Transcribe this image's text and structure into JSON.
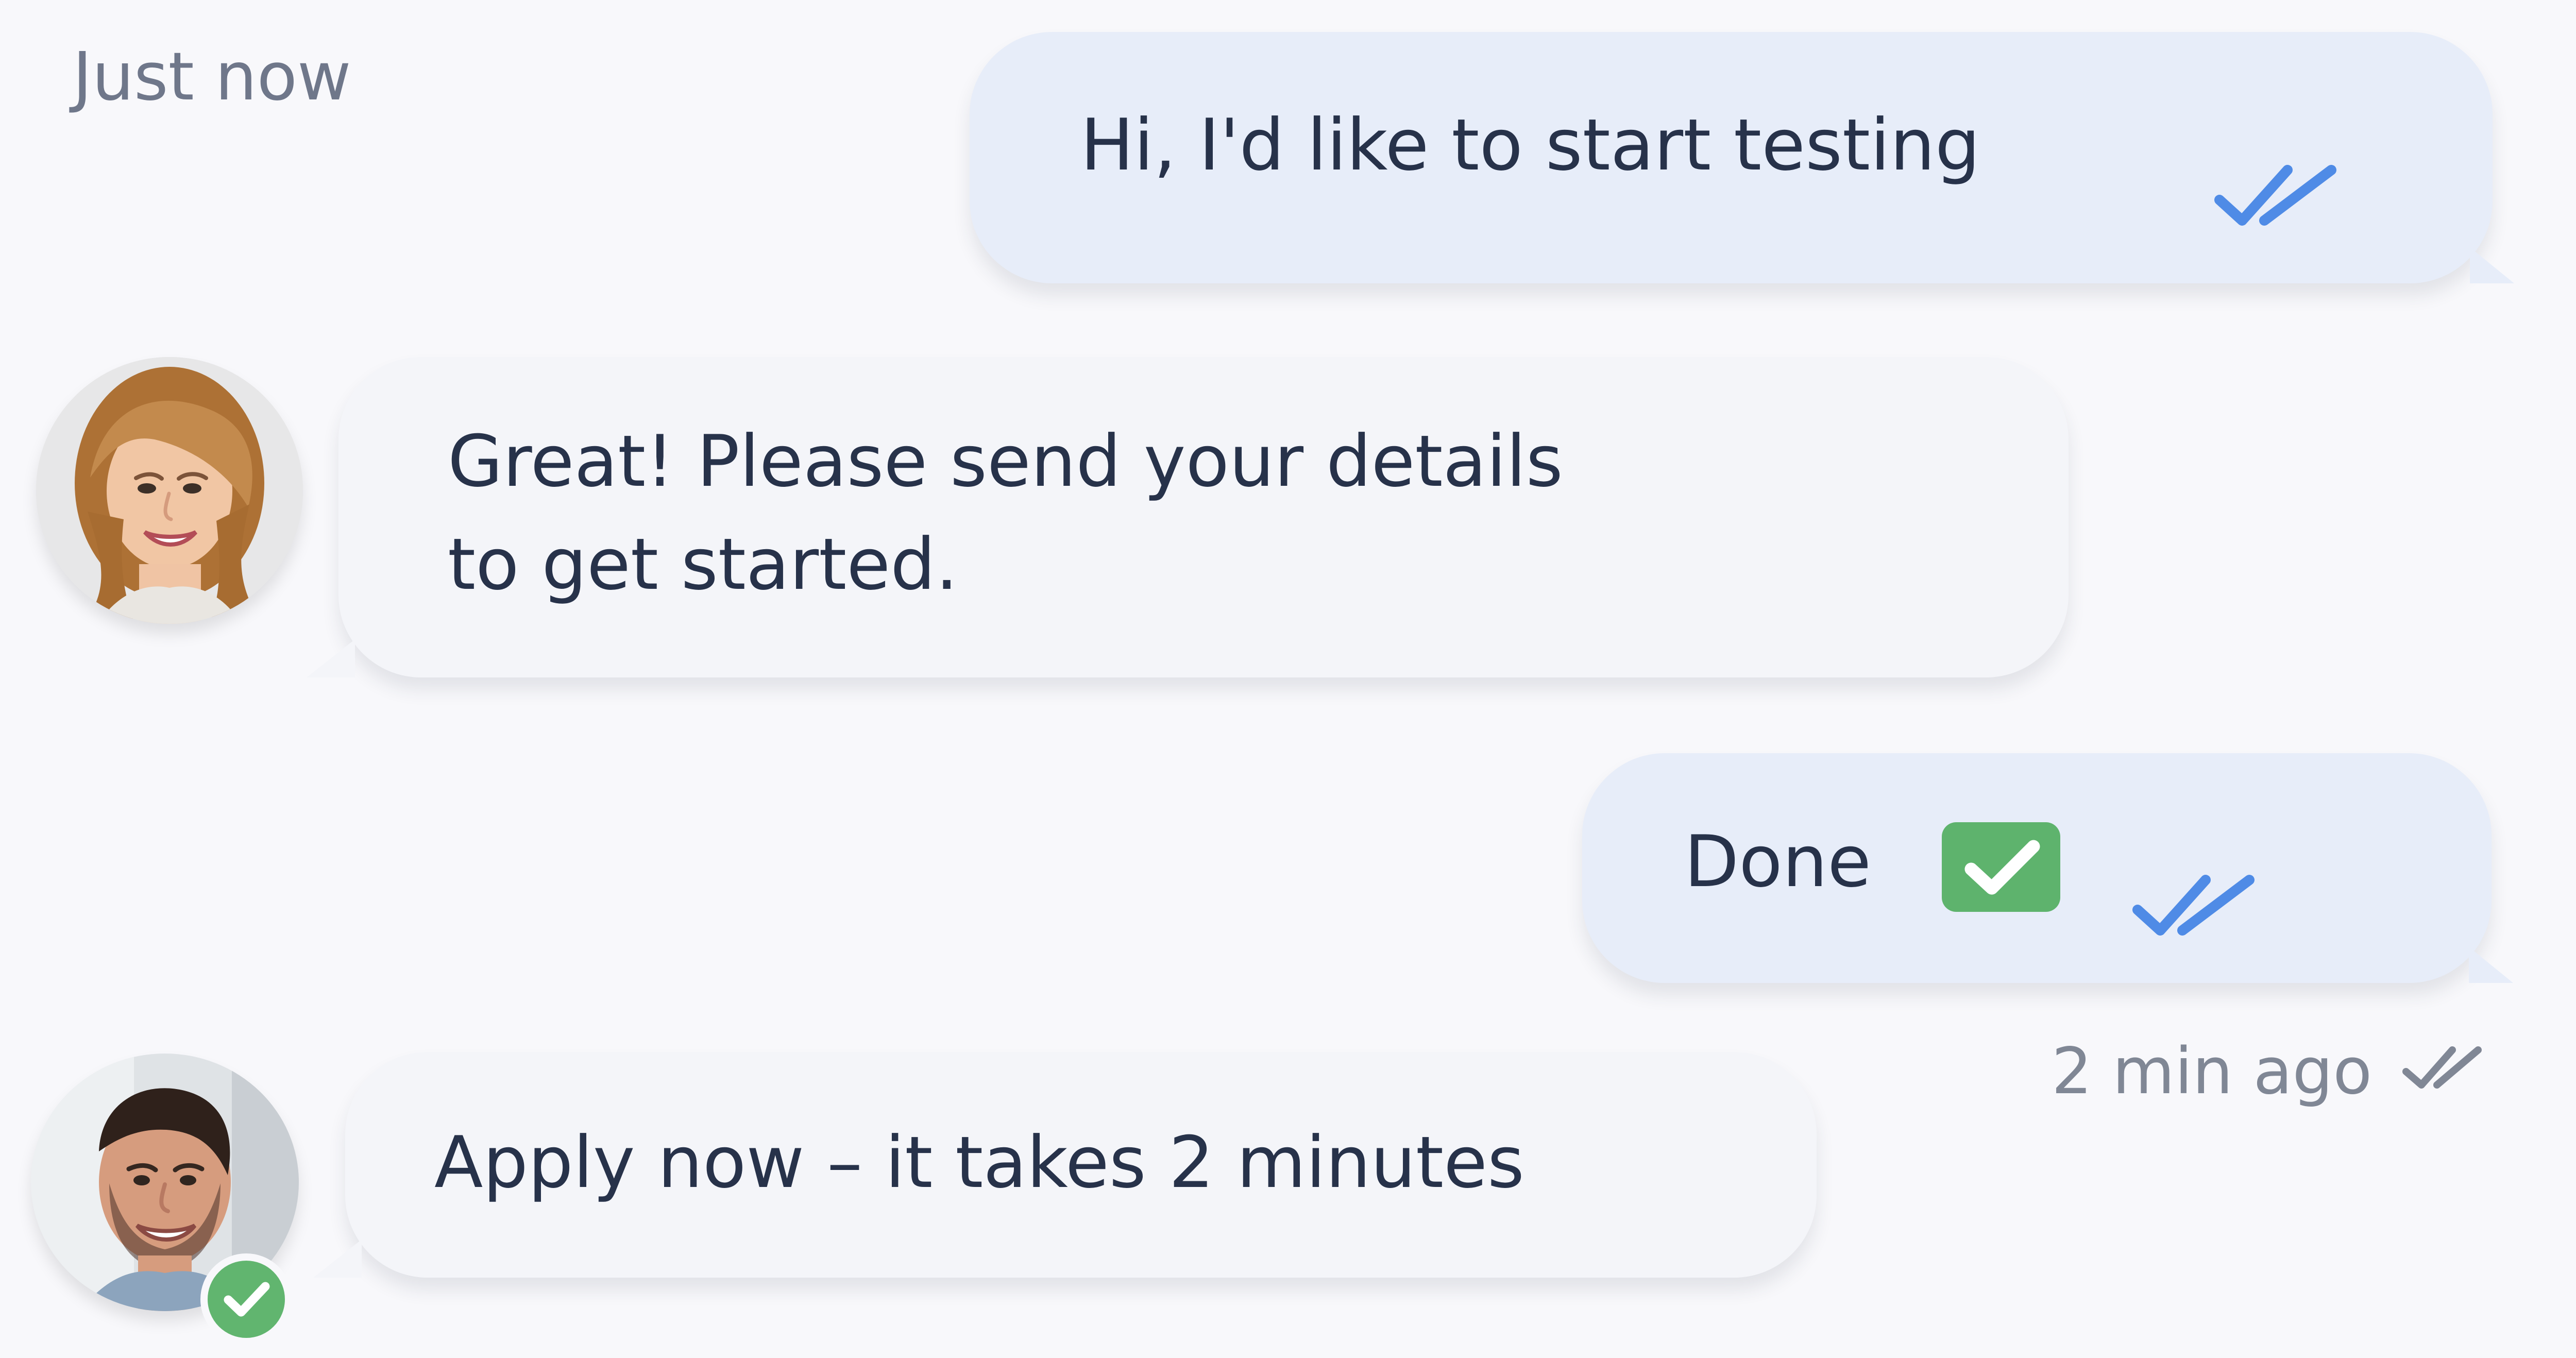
{
  "timestamps": {
    "top": "Just now",
    "bottom": "2 min ago"
  },
  "messages": [
    {
      "direction": "outgoing",
      "text": "Hi, I'd like to start testing",
      "status_icon": "double-check-icon"
    },
    {
      "direction": "incoming",
      "sender_avatar": "woman-avatar",
      "lines": [
        "Great! Please send your details",
        "to get started."
      ]
    },
    {
      "direction": "outgoing",
      "text": "Done",
      "emoji_icon": "green-check-box-icon",
      "status_icon": "double-check-icon"
    },
    {
      "direction": "incoming",
      "sender_avatar": "man-avatar",
      "verified_icon": "verified-check-icon",
      "text": "Apply now – it takes 2 minutes"
    }
  ],
  "colors": {
    "background": "#f8f8fb",
    "outgoing_bubble": "#e7edf9",
    "incoming_bubble": "#f4f5f9",
    "text": "#27324a",
    "muted_text": "#6f778a",
    "tick_blue": "#4f8be6",
    "success_green": "#5eb36d"
  }
}
